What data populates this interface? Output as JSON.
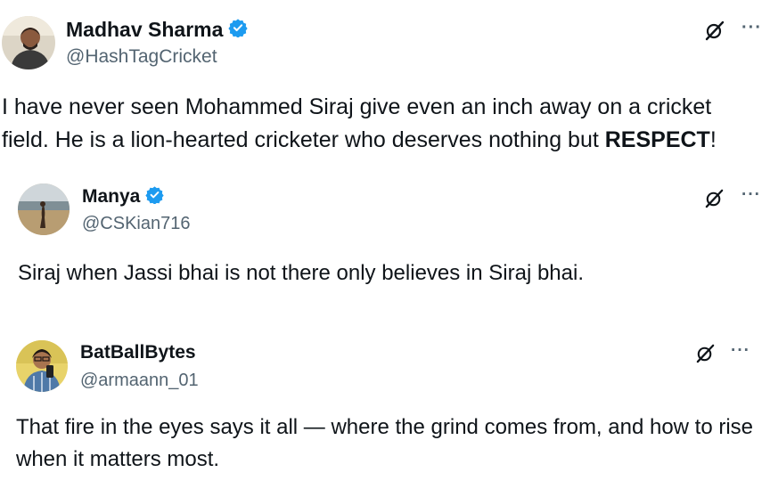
{
  "posts": [
    {
      "name": "Madhav Sharma",
      "handle": "@HashTagCricket",
      "text_before": "I have never seen Mohammed Siraj give even an inch away on a cricket field. He is a lion-hearted cricketer who deserves nothing but ",
      "text_bold": "RESPECT",
      "text_after": "!",
      "verified": true,
      "more_label": "···",
      "avatar_icon": "person-photo"
    },
    {
      "name": "Manya",
      "handle": "@CSKian716",
      "text": "Siraj when Jassi bhai is not there only believes in Siraj bhai.",
      "verified": true,
      "more_label": "···",
      "avatar_icon": "beach-photo"
    },
    {
      "name": "BatBallBytes",
      "handle": "@armaann_01",
      "text": "That fire in the eyes says it all — where the grind comes from, and how to rise when it matters most.",
      "verified": false,
      "more_label": "···",
      "avatar_icon": "person-photo"
    }
  ],
  "colors": {
    "text": "#0f1419",
    "secondary": "#536471",
    "verified": "#1d9bf0"
  }
}
